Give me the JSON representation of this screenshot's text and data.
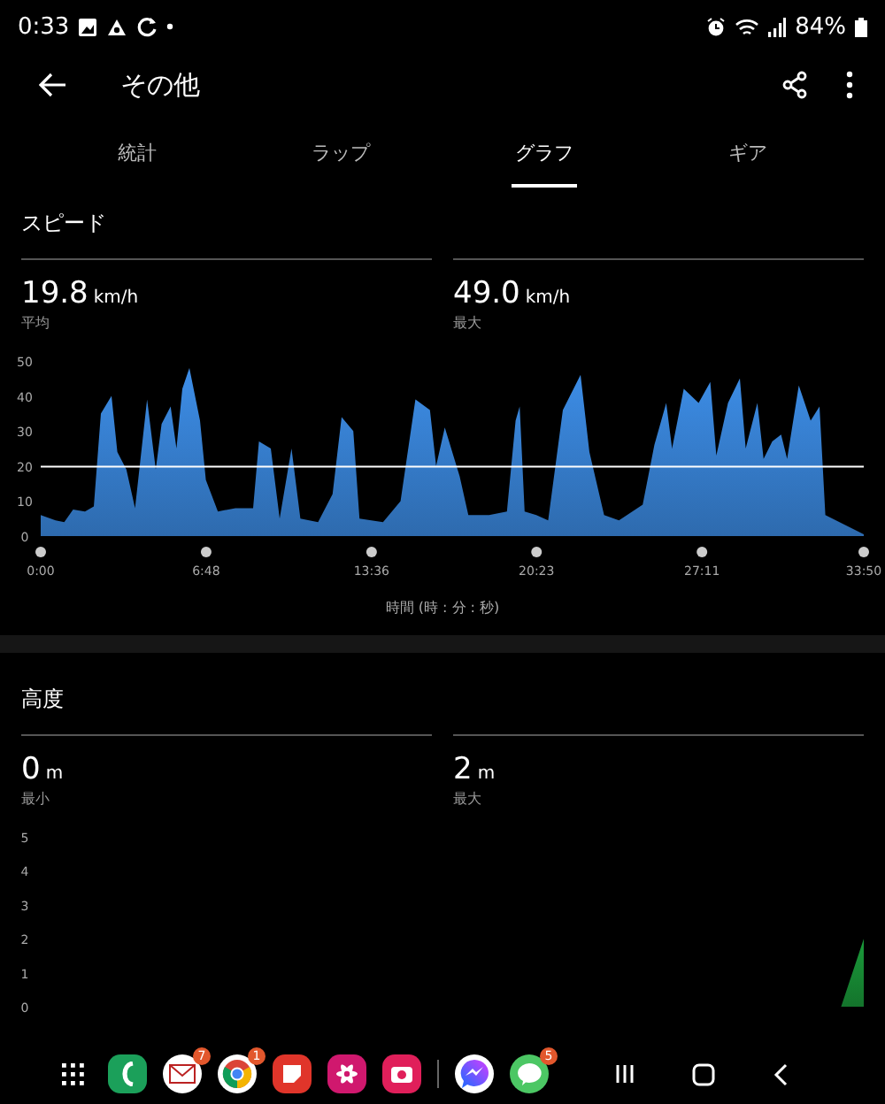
{
  "status_bar": {
    "time": "0:33",
    "battery": "84%"
  },
  "app_bar": {
    "title": "その他"
  },
  "tabs": [
    {
      "label": "統計",
      "selected": false
    },
    {
      "label": "ラップ",
      "selected": false
    },
    {
      "label": "グラフ",
      "selected": true
    },
    {
      "label": "ギア",
      "selected": false
    }
  ],
  "sections": [
    {
      "title": "スピード",
      "stats": [
        {
          "value": "19.8",
          "unit": "km/h",
          "label": "平均"
        },
        {
          "value": "49.0",
          "unit": "km/h",
          "label": "最大"
        }
      ],
      "chart_data": {
        "type": "area",
        "xlabel": "時間 (時 : 分 : 秒)",
        "x": [
          0,
          0.61,
          0.97,
          1.33,
          1.82,
          2.18,
          2.47,
          2.91,
          3.15,
          3.52,
          3.88,
          4.37,
          4.73,
          4.97,
          5.34,
          5.58,
          5.82,
          6.11,
          6.55,
          6.79,
          7.28,
          8.0,
          8.73,
          8.97,
          9.46,
          9.82,
          10.31,
          10.67,
          11.4,
          12.0,
          12.37,
          12.85,
          13.1,
          14.07,
          14.79,
          15.4,
          16.0,
          16.25,
          16.61,
          17.22,
          17.58,
          18.43,
          19.16,
          19.52,
          19.69,
          19.89,
          20.37,
          20.86,
          21.46,
          22.19,
          22.55,
          23.16,
          23.77,
          24.74,
          25.22,
          25.71,
          25.95,
          26.43,
          27.04,
          27.52,
          27.77,
          28.25,
          28.74,
          28.98,
          29.46,
          29.71,
          30.07,
          30.43,
          30.68,
          31.16,
          31.65,
          32.01,
          32.25,
          33.83
        ],
        "series": [
          {
            "color": "#3d8ee8",
            "values": [
              6,
              4.5,
              4,
              7.6,
              7,
              8.5,
              35,
              40,
              24,
              19,
              8,
              39,
              19,
              32,
              37,
              25,
              42,
              48,
              33,
              16,
              7,
              8,
              8,
              27,
              25,
              5,
              25,
              5,
              4,
              12,
              34,
              30,
              5,
              4,
              10,
              39,
              36,
              20,
              31,
              17,
              6,
              6,
              7,
              33,
              37,
              7,
              6,
              4.5,
              36,
              46,
              24,
              6,
              4.5,
              9,
              26,
              38,
              25,
              42,
              38,
              44,
              23,
              38,
              45,
              25,
              38,
              22,
              27,
              29,
              22,
              43,
              33,
              37,
              6,
              0.5
            ]
          }
        ],
        "xlim": [
          0,
          33.83
        ],
        "ylim": [
          0,
          50
        ],
        "xticks": [
          {
            "value": 0,
            "label": "0:00"
          },
          {
            "value": 6.8,
            "label": "6:48"
          },
          {
            "value": 13.6,
            "label": "13:36"
          },
          {
            "value": 20.38,
            "label": "20:23"
          },
          {
            "value": 27.18,
            "label": "27:11"
          },
          {
            "value": 33.83,
            "label": "33:50"
          }
        ],
        "yticks": [
          {
            "value": 0,
            "label": "0"
          },
          {
            "value": 10,
            "label": "10"
          },
          {
            "value": 20,
            "label": "20"
          },
          {
            "value": 30,
            "label": "30"
          },
          {
            "value": 40,
            "label": "40"
          },
          {
            "value": 50,
            "label": "50"
          }
        ],
        "ref_lines": [
          {
            "axis": "y",
            "value": 19.8
          }
        ]
      }
    },
    {
      "title": "高度",
      "stats": [
        {
          "value": "0",
          "unit": "m",
          "label": "最小"
        },
        {
          "value": "2",
          "unit": "m",
          "label": "最大"
        }
      ],
      "chart_data": {
        "type": "area",
        "x": [
          0,
          32.9,
          33.83
        ],
        "series": [
          {
            "color": "#1a9a3a",
            "values": [
              0,
              0,
              2
            ]
          }
        ],
        "xlim": [
          0,
          33.83
        ],
        "ylim": [
          0,
          5
        ],
        "yticks": [
          {
            "value": 0,
            "label": "0"
          },
          {
            "value": 1,
            "label": "1"
          },
          {
            "value": 2,
            "label": "2"
          },
          {
            "value": 3,
            "label": "3"
          },
          {
            "value": 4,
            "label": "4"
          },
          {
            "value": 5,
            "label": "5"
          }
        ]
      }
    }
  ],
  "dock": {
    "apps": [
      {
        "kind": "apps"
      },
      {
        "kind": "phone"
      },
      {
        "kind": "mail",
        "badge": "7"
      },
      {
        "kind": "browser",
        "badge": "1"
      },
      {
        "kind": "notes"
      },
      {
        "kind": "flower"
      },
      {
        "kind": "camera"
      },
      {
        "kind": "separator"
      },
      {
        "kind": "messenger"
      },
      {
        "kind": "chat",
        "badge": "5"
      }
    ]
  }
}
